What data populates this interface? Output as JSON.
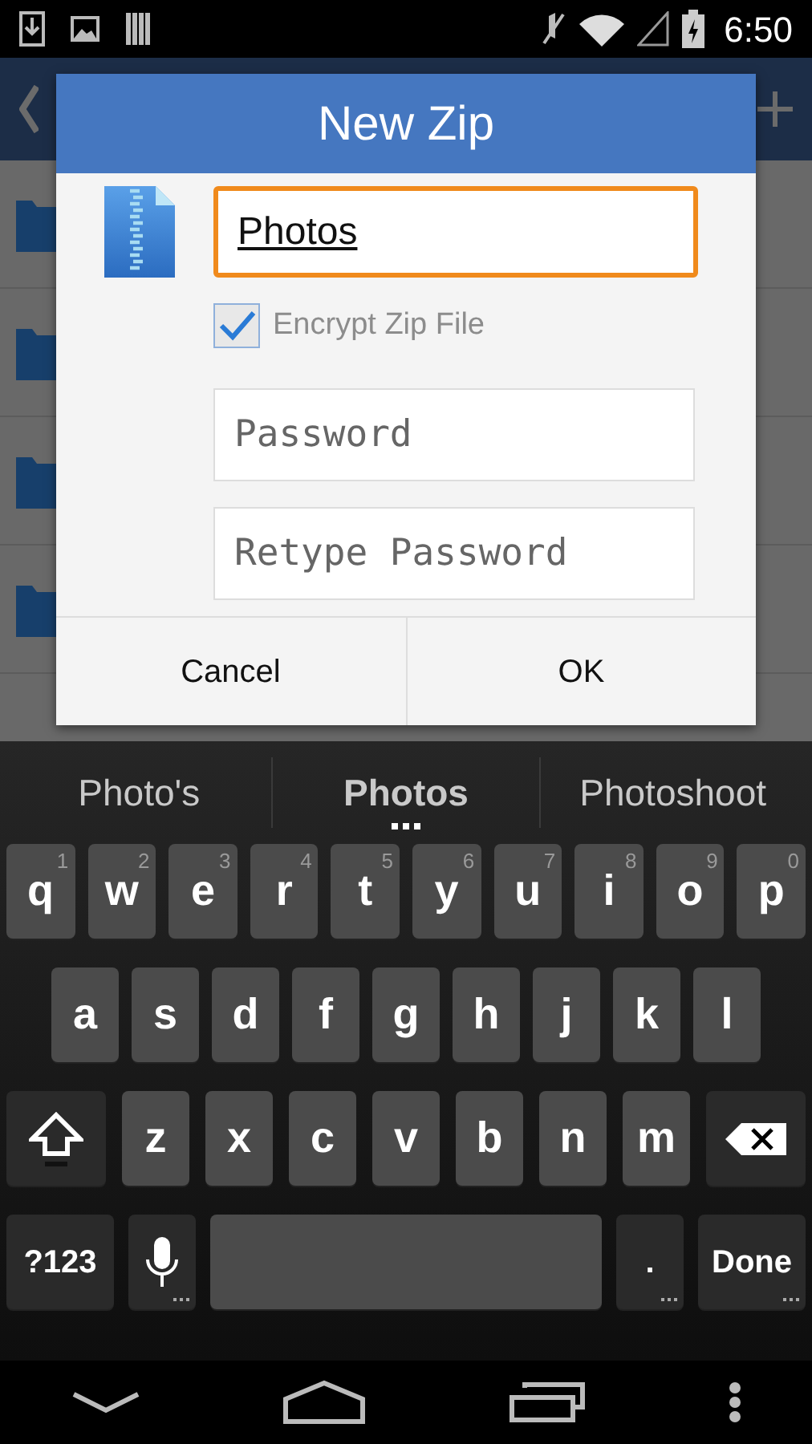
{
  "status_bar": {
    "time": "6:50"
  },
  "file_list": [
    {
      "kind": "folder"
    },
    {
      "kind": "folder"
    },
    {
      "kind": "folder"
    },
    {
      "kind": "folder"
    }
  ],
  "dialog": {
    "title": "New Zip",
    "name_field": {
      "value": "Photos",
      "focused": true
    },
    "encrypt": {
      "label": "Encrypt Zip File",
      "checked": true
    },
    "password_fields": [
      {
        "placeholder": "Password"
      },
      {
        "placeholder": "Retype Password"
      }
    ],
    "buttons": [
      "Cancel",
      "OK"
    ]
  },
  "keyboard": {
    "suggestions": [
      {
        "text": "Photo's",
        "selected": false
      },
      {
        "text": "Photos",
        "selected": true
      },
      {
        "text": "Photoshoot",
        "selected": false
      }
    ],
    "rows": [
      [
        {
          "kind": "letter",
          "label": "q",
          "hint": "1"
        },
        {
          "kind": "letter",
          "label": "w",
          "hint": "2"
        },
        {
          "kind": "letter",
          "label": "e",
          "hint": "3"
        },
        {
          "kind": "letter",
          "label": "r",
          "hint": "4"
        },
        {
          "kind": "letter",
          "label": "t",
          "hint": "5"
        },
        {
          "kind": "letter",
          "label": "y",
          "hint": "6"
        },
        {
          "kind": "letter",
          "label": "u",
          "hint": "7"
        },
        {
          "kind": "letter",
          "label": "i",
          "hint": "8"
        },
        {
          "kind": "letter",
          "label": "o",
          "hint": "9"
        },
        {
          "kind": "letter",
          "label": "p",
          "hint": "0"
        }
      ],
      [
        {
          "kind": "letter",
          "label": "a"
        },
        {
          "kind": "letter",
          "label": "s"
        },
        {
          "kind": "letter",
          "label": "d"
        },
        {
          "kind": "letter",
          "label": "f"
        },
        {
          "kind": "letter",
          "label": "g"
        },
        {
          "kind": "letter",
          "label": "h"
        },
        {
          "kind": "letter",
          "label": "j"
        },
        {
          "kind": "letter",
          "label": "k"
        },
        {
          "kind": "letter",
          "label": "l"
        }
      ],
      [
        {
          "kind": "shift"
        },
        {
          "kind": "letter",
          "label": "z"
        },
        {
          "kind": "letter",
          "label": "x"
        },
        {
          "kind": "letter",
          "label": "c"
        },
        {
          "kind": "letter",
          "label": "v"
        },
        {
          "kind": "letter",
          "label": "b"
        },
        {
          "kind": "letter",
          "label": "n"
        },
        {
          "kind": "letter",
          "label": "m"
        },
        {
          "kind": "backspace"
        }
      ]
    ],
    "bottom_row": {
      "symbols_key": {
        "label": "?123"
      },
      "mic_key": {
        "long_press": true
      },
      "period_key": {
        "label": ".",
        "long_press": true
      },
      "done_key": {
        "label": "Done",
        "long_press": true
      }
    }
  }
}
